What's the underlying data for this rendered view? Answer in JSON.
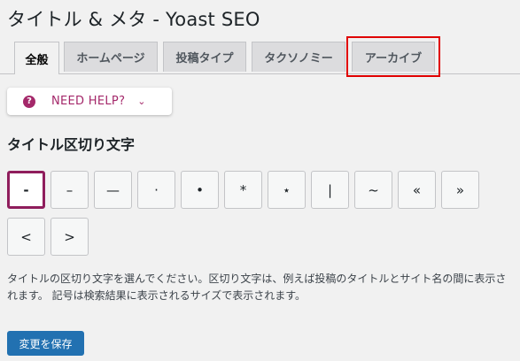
{
  "page": {
    "title": "タイトル & メタ - Yoast SEO"
  },
  "tabs": [
    {
      "label": "全般"
    },
    {
      "label": "ホームページ"
    },
    {
      "label": "投稿タイプ"
    },
    {
      "label": "タクソノミー"
    },
    {
      "label": "アーカイブ"
    }
  ],
  "help": {
    "icon": "?",
    "label": "NEED HELP?",
    "chevron": "⌄"
  },
  "separator_section": {
    "title": "タイトル区切り文字",
    "options": [
      "-",
      "–",
      "—",
      "·",
      "•",
      "*",
      "⋆",
      "|",
      "~",
      "«",
      "»",
      "<",
      ">"
    ],
    "selected_index": 0
  },
  "description": "タイトルの区切り文字を選んでください。区切り文字は、例えば投稿のタイトルとサイト名の間に表示されます。 記号は検索結果に表示されるサイズで表示されます。",
  "save_button": {
    "label": "変更を保存"
  },
  "colors": {
    "accent": "#a4286a",
    "primary": "#2271b1",
    "highlight": "#e00000"
  }
}
